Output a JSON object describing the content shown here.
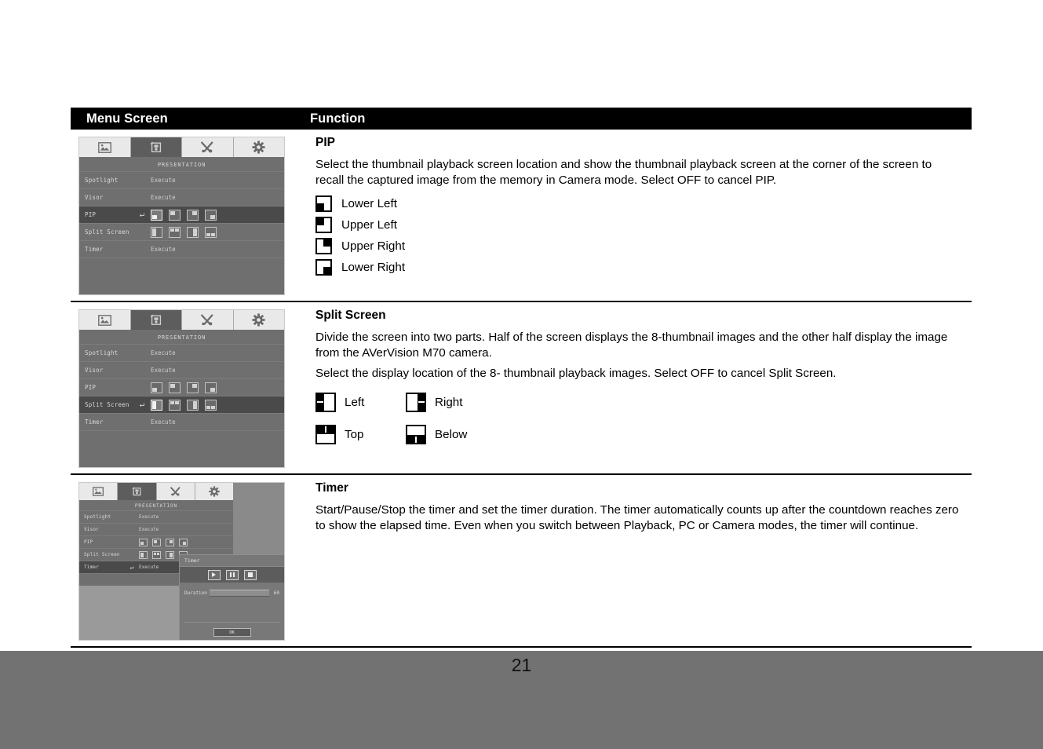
{
  "page": {
    "number": "21"
  },
  "table": {
    "headers": {
      "menu_screen": "Menu Screen",
      "function": "Function"
    },
    "rows": [
      {
        "id": "pip",
        "title": "PIP",
        "paragraphs": [
          "Select the thumbnail playback screen location and show the thumbnail playback screen at the corner of the screen to recall the captured image from the memory in Camera mode. Select OFF to cancel PIP."
        ],
        "options": [
          {
            "icon": "pip-lower-left-icon",
            "label": "Lower Left"
          },
          {
            "icon": "pip-upper-left-icon",
            "label": "Upper Left"
          },
          {
            "icon": "pip-upper-right-icon",
            "label": "Upper Right"
          },
          {
            "icon": "pip-lower-right-icon",
            "label": "Lower Right"
          }
        ]
      },
      {
        "id": "split-screen",
        "title": "Split Screen",
        "paragraphs": [
          "Divide the screen into two parts. Half of the screen displays the 8-thumbnail images and the other half display the image from the AVerVision M70 camera.",
          "Select the display location of the 8- thumbnail playback images. Select OFF to cancel Split Screen."
        ],
        "options": [
          {
            "icon": "split-left-icon",
            "label": "Left"
          },
          {
            "icon": "split-right-icon",
            "label": "Right"
          },
          {
            "icon": "split-top-icon",
            "label": "Top"
          },
          {
            "icon": "split-below-icon",
            "label": "Below"
          }
        ]
      },
      {
        "id": "timer",
        "title": "Timer",
        "paragraphs": [
          "Start/Pause/Stop the timer and set the timer duration. The timer automatically counts up after the countdown reaches zero to show the elapsed time. Even when you switch between Playback, PC or Camera modes, the timer will continue."
        ],
        "options": []
      }
    ]
  },
  "osd": {
    "tabs": [
      {
        "name": "picture-tab",
        "icon": "picture-icon",
        "active": false
      },
      {
        "name": "presentation-tab",
        "icon": "presentation-icon",
        "active": true
      },
      {
        "name": "tools-tab",
        "icon": "tools-icon",
        "active": false
      },
      {
        "name": "settings-tab",
        "icon": "gear-icon",
        "active": false
      }
    ],
    "title": "PRESENTATION",
    "enter_glyph": "↵",
    "rows": {
      "spotlight": {
        "label": "Spotlight",
        "value": "Execute"
      },
      "visor": {
        "label": "Visor",
        "value": "Execute"
      },
      "pip": {
        "label": "PIP"
      },
      "split": {
        "label": "Split Screen"
      },
      "timer": {
        "label": "Timer",
        "value": "Execute"
      }
    },
    "timer_dialog": {
      "title": "Timer",
      "buttons": [
        {
          "name": "timer-play-button",
          "label": "play"
        },
        {
          "name": "timer-pause-button",
          "label": "pause"
        },
        {
          "name": "timer-stop-button",
          "label": "stop"
        }
      ],
      "duration_label": "Duration",
      "duration_value": "60",
      "ok_label": "OK"
    }
  }
}
